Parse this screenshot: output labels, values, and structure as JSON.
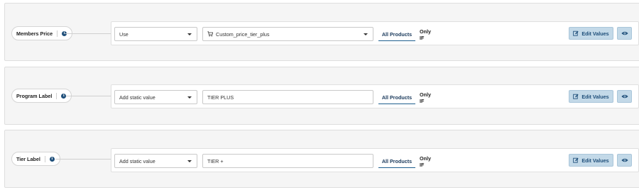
{
  "colors": {
    "accent": "#1f4f7a",
    "button_bg": "#c3d9e8",
    "section_bg": "#f5f5f5"
  },
  "rows": [
    {
      "field_label": "Members Price",
      "info_icon": "info-icon",
      "source_select": "Use",
      "value_mode": "select",
      "value": "Custom_price_tier_plus",
      "value_icon": "cart-icon",
      "tab_all": "All Products",
      "tab_only": "Only IF",
      "edit_label": "Edit Values",
      "edit_icon": "edit-icon",
      "preview_icon": "eye-icon"
    },
    {
      "field_label": "Program Label",
      "info_icon": "info-icon",
      "source_select": "Add static value",
      "value_mode": "text",
      "value": "TIER PLUS",
      "tab_all": "All Products",
      "tab_only": "Only IF",
      "edit_label": "Edit Values",
      "edit_icon": "edit-icon",
      "preview_icon": "eye-icon"
    },
    {
      "field_label": "Tier Label",
      "info_icon": "info-icon",
      "source_select": "Add static value",
      "value_mode": "text",
      "value": "TIER +",
      "tab_all": "All Products",
      "tab_only": "Only IF",
      "edit_label": "Edit Values",
      "edit_icon": "edit-icon",
      "preview_icon": "eye-icon"
    }
  ]
}
